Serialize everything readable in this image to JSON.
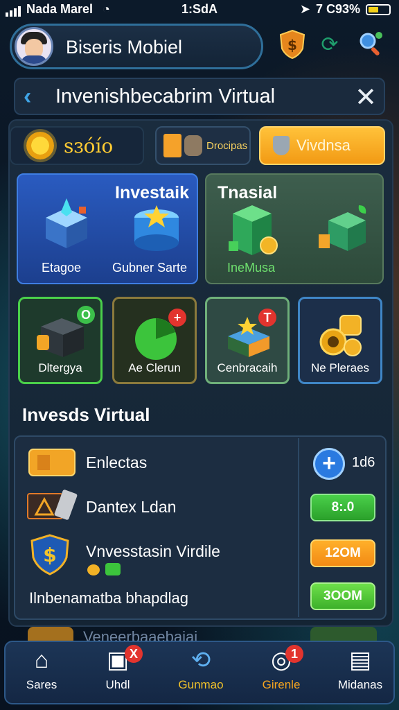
{
  "status": {
    "carrier": "Nada Marel",
    "time": "1:SdA",
    "battery_text": "7 C93%"
  },
  "profile": {
    "name": "Biseris Mobiel"
  },
  "header": {
    "title": "Invenishbecabrim Virtual"
  },
  "tabs": [
    {
      "label": "sɜóío"
    },
    {
      "label": "Drocipas"
    },
    {
      "label": "Vivdnsa",
      "active": true
    }
  ],
  "cards": {
    "invest": {
      "title": "Investaik",
      "items": [
        {
          "label": "Etagoe"
        },
        {
          "label": "Gubner Sarte"
        }
      ]
    },
    "trial": {
      "title": "Tnasial",
      "items": [
        {
          "label": "IneMusa"
        }
      ]
    }
  },
  "small_cards": [
    {
      "label": "Dltergya"
    },
    {
      "label": "Ae Clerun"
    },
    {
      "label": "Cenbracaih"
    },
    {
      "label": "Ne Pleraes"
    }
  ],
  "section": {
    "title": "Invesds Virtual"
  },
  "list": [
    {
      "label": "Enlectas",
      "action": "1d6"
    },
    {
      "label": "Dantex Ldan",
      "action": "8:.0"
    },
    {
      "label": "Vnvesstasin Virdile",
      "action": "12OM"
    },
    {
      "label": "Ilnbenamatba bhapdlag",
      "action": "3OOM"
    }
  ],
  "partial_row": {
    "label": "Veneerbaaebaiai"
  },
  "nav": [
    {
      "label": "Sares"
    },
    {
      "label": "Uhdl"
    },
    {
      "label": "Gunmao"
    },
    {
      "label": "Girenle"
    },
    {
      "label": "Midanas"
    }
  ],
  "badges": {
    "card_a": "O",
    "card_b": "+",
    "card_c": "T",
    "nav_uhdl": "X",
    "nav_girenle": "1"
  },
  "colors": {
    "accent": "#f7a51f",
    "primary": "#2a5bc0",
    "success": "#4ad04a",
    "danger": "#e2342e"
  }
}
